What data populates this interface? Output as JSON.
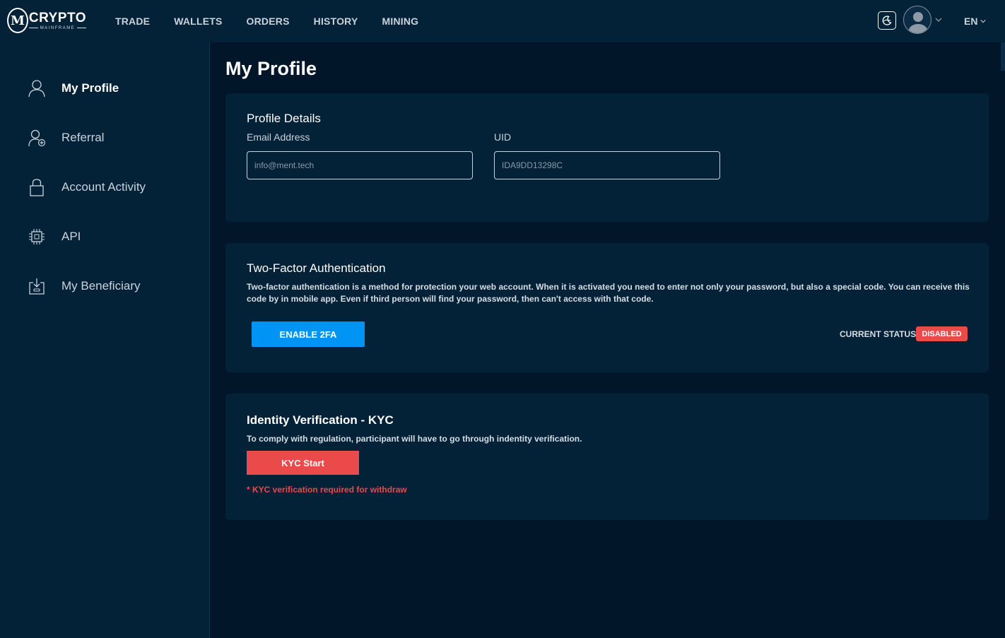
{
  "brand": {
    "name": "CRYPTO",
    "subtitle": "MAINFRAME",
    "mark": "M"
  },
  "nav": [
    "TRADE",
    "WALLETS",
    "ORDERS",
    "HISTORY",
    "MINING"
  ],
  "topbar": {
    "language": "EN"
  },
  "sidebar": {
    "items": [
      {
        "label": "My Profile",
        "icon": "user-icon",
        "active": true
      },
      {
        "label": "Referral",
        "icon": "user-add-icon",
        "active": false
      },
      {
        "label": "Account Activity",
        "icon": "lock-icon",
        "active": false
      },
      {
        "label": "API",
        "icon": "chip-icon",
        "active": false
      },
      {
        "label": "My Beneficiary",
        "icon": "inbox-download-icon",
        "active": false
      }
    ]
  },
  "page": {
    "title": "My Profile"
  },
  "profile": {
    "title": "Profile Details",
    "email_label": "Email Address",
    "email_value": "info@ment.tech",
    "uid_label": "UID",
    "uid_value": "IDA9DD13298C"
  },
  "twofa": {
    "title": "Two-Factor Authentication",
    "description": "Two-factor authentication is a method for protection your web account. When it is activated you need to enter not only your password, but also a special code. You can receive this code by in mobile app. Even if third person will find your password, then can't access with that code.",
    "button": "ENABLE 2FA",
    "status_label": "CURRENT STATUS:",
    "status_value": "DISABLED"
  },
  "kyc": {
    "title": "Identity Verification - KYC",
    "description": "To comply with regulation, participant will have to go through indentity verification.",
    "button": "KYC Start",
    "note": "* KYC verification required for withdraw"
  },
  "colors": {
    "background": "#02162a",
    "panel": "#032137",
    "accent_blue": "#0094f5",
    "accent_red": "#ea4a4a"
  }
}
